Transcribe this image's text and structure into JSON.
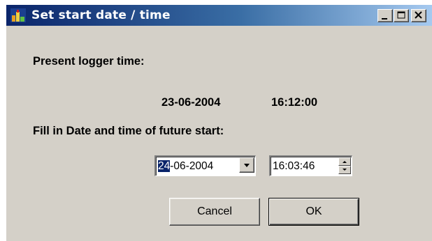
{
  "window": {
    "title": "Set start date / time"
  },
  "present": {
    "label": "Present logger time:",
    "date": "23-06-2004",
    "time": "16:12:00"
  },
  "future": {
    "label": "Fill in Date and time of future start:",
    "date_selected_part": "24",
    "date_rest": "-06-2004",
    "time_value": "16:03:46"
  },
  "buttons": {
    "cancel_label": "Cancel",
    "ok_label": "OK"
  },
  "icons": {
    "app": "logger-app-icon",
    "minimize": "minimize-icon",
    "maximize": "maximize-icon",
    "close": "close-icon",
    "dropdown": "chevron-down-icon",
    "spin_up": "spin-up-icon",
    "spin_down": "spin-down-icon"
  },
  "colors": {
    "title_gradient_start": "#0a246a",
    "title_gradient_end": "#a6caf0",
    "face": "#d4d0c8",
    "selection": "#0a246a"
  }
}
